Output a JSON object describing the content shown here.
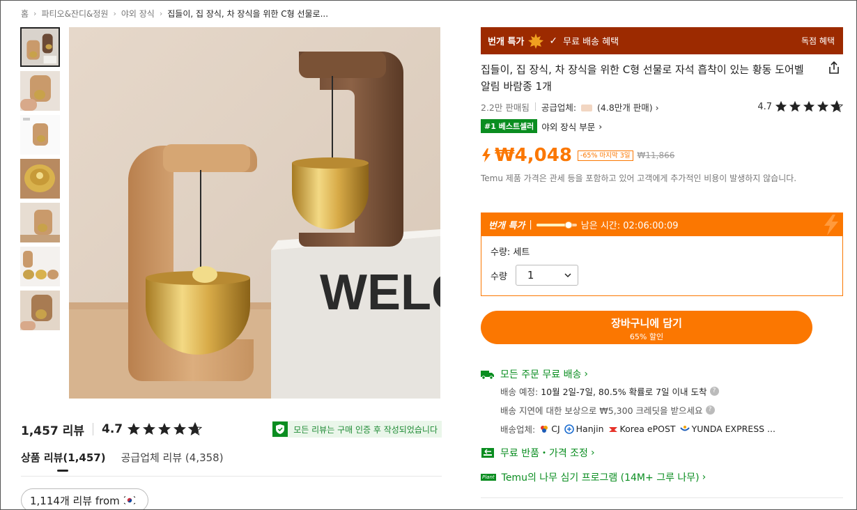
{
  "breadcrumb": [
    "홈",
    "파티오&잔디&정원",
    "야외 장식",
    "집들이, 집 장식, 차 장식을 위한 C형 선물로..."
  ],
  "reviews": {
    "count_label": "1,457 리뷰",
    "rating": "4.7",
    "stars": 4.7,
    "verified_text": "모든 리뷰는 구매 인증 후 작성되었습니다",
    "tabs": [
      "상품 리뷰(1,457)",
      "공급업체 리뷰 (4,358)"
    ],
    "filter_label": "1,114개 리뷰 from"
  },
  "promo": {
    "flash_label": "번개 특가",
    "free_shipping": "무료 배송 혜택",
    "exclusive": "독점 혜택"
  },
  "product": {
    "title": "집들이, 집 장식, 차 장식을 위한 C형 선물로 자석 흡착이 있는 황동 도어벨 알림 바람종 1개",
    "sold": "2.2만 판매됨",
    "supplier_prefix": "공급업체:",
    "supplier_sales": "(4.8만개 판매)",
    "rating": "4.7",
    "stars": 4.7,
    "best_badge": "#1 베스트셀러",
    "best_category": "야외 장식 부문",
    "price": "₩4,048",
    "discount_tag": "-65% 마지막 3일",
    "old_price": "₩11,866",
    "tax_note": "Temu 제품 가격은 관세 등을 포함하고 있어 고객에게 추가적인 비용이 발생하지 않습니다."
  },
  "flash_sale": {
    "title": "번개 특가",
    "pipe": "|",
    "remaining": "남은 시간: 02:06:00:09",
    "quantity_info": "수량: 세트",
    "quantity_label": "수량",
    "quantity_value": "1"
  },
  "cart": {
    "label": "장바구니에 담기",
    "sub": "65% 할인"
  },
  "shipping": {
    "free_all": "모든 주문 무료 배송",
    "eta_prefix": "배송 예정:",
    "eta_value": "10월 2일-7일, 80.5% 확률로 7일 이내 도착",
    "delay_note": "배송 지연에 대한 보상으로 ₩5,300 크레딧을 받으세요",
    "carriers_prefix": "배송업체:",
    "carriers": [
      "CJ",
      "Hanjin",
      "Korea ePOST",
      "YUNDA EXPRESS ..."
    ]
  },
  "links": {
    "free_return": "무료 반품・가격 조정",
    "tree_program": "Temu의 나무 심기 프로그램 (14M+ 그루 나무)",
    "plant_badge": "Plant"
  },
  "colors": {
    "accent": "#fb7701",
    "promo_red": "#9c2a00",
    "green": "#0a8d20"
  }
}
